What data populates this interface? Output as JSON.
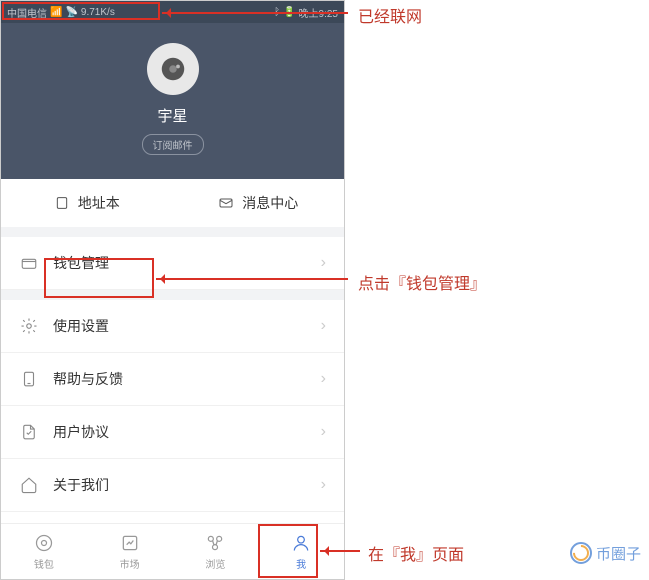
{
  "status_bar": {
    "carrier": "中国电信",
    "speed": "9.71K/s",
    "time": "晚上9:25"
  },
  "profile": {
    "username": "宇星",
    "subscribe": "订阅邮件"
  },
  "quick_actions": {
    "address_book": "地址本",
    "message_center": "消息中心"
  },
  "menu": {
    "wallet_manage": "钱包管理",
    "settings": "使用设置",
    "help": "帮助与反馈",
    "agreement": "用户协议",
    "about": "关于我们"
  },
  "bottom_nav": {
    "wallet": "钱包",
    "market": "市场",
    "browse": "浏览",
    "me": "我"
  },
  "annotations": {
    "networked": "已经联网",
    "click_wallet": "点击『钱包管理』",
    "on_me_page": "在『我』页面"
  },
  "watermark": "币圈子"
}
